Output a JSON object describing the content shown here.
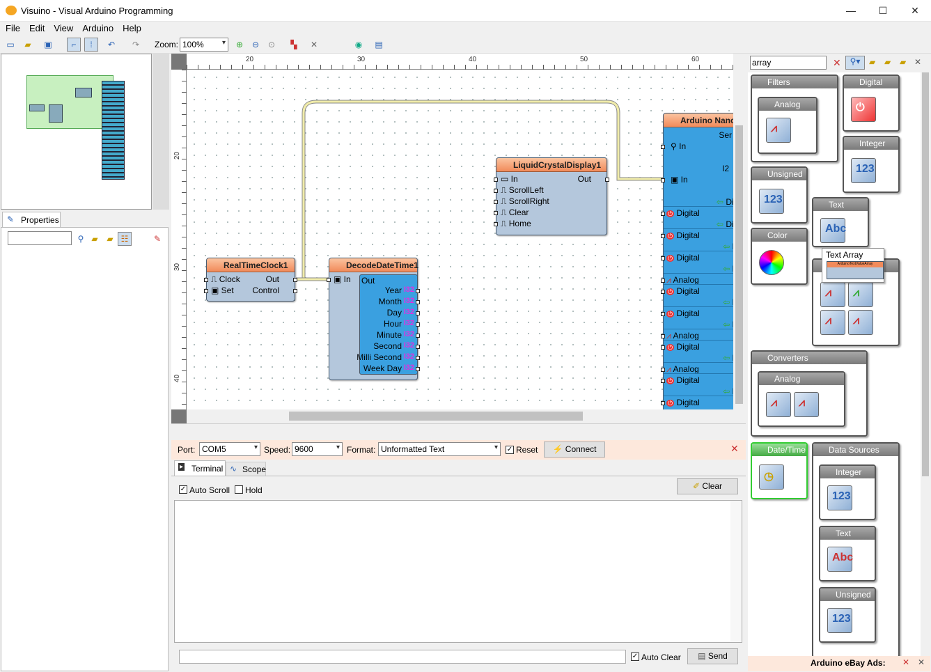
{
  "window": {
    "title": "Visuino - Visual Arduino Programming",
    "min": "—",
    "max": "☐",
    "close": "✕"
  },
  "menu": [
    "File",
    "Edit",
    "View",
    "Arduino",
    "Help"
  ],
  "toolbar": {
    "zoom_label": "Zoom:",
    "zoom_value": "100%"
  },
  "properties": {
    "tab": "Properties"
  },
  "ruler": {
    "top": [
      "20",
      "30",
      "40",
      "50",
      "60"
    ],
    "left": [
      "20",
      "30",
      "40"
    ]
  },
  "components": {
    "rtc": {
      "title": "RealTimeClock1",
      "pins": [
        "Clock",
        "Set"
      ],
      "outs": [
        "Out",
        "Control"
      ]
    },
    "decode": {
      "title": "DecodeDateTime1",
      "in": "In",
      "out": "Out",
      "outs": [
        "Year",
        "Month",
        "Day",
        "Hour",
        "Minute",
        "Second",
        "Milli Second",
        "Week Day"
      ],
      "type": "I32"
    },
    "lcd": {
      "title": "LiquidCrystalDisplay1",
      "ins": [
        "In",
        "ScrollLeft",
        "ScrollRight",
        "Clear",
        "Home"
      ],
      "out": "Out"
    },
    "nano": {
      "title": "Arduino Nano",
      "ser": "Ser",
      "in1": "In",
      "in2": "In",
      "i2": "I2",
      "rows": [
        "Digital",
        "Digital",
        "Digital",
        "Analog",
        "Digital",
        "Digital",
        "Analog",
        "Digital",
        "Analog",
        "Digital",
        "Digital"
      ],
      "right": [
        "Digi",
        "Digi",
        "Di",
        "Di",
        "Di",
        "Di",
        "Di",
        "Di"
      ]
    }
  },
  "serial": {
    "port_label": "Port:",
    "port": "COM5",
    "speed_label": "Speed:",
    "speed": "9600",
    "format_label": "Format:",
    "format": "Unformatted Text",
    "reset": "Reset",
    "connect": "Connect",
    "tabs": [
      "Terminal",
      "Scope"
    ],
    "auto_scroll": "Auto Scroll",
    "hold": "Hold",
    "clear": "Clear",
    "auto_clear": "Auto Clear",
    "send": "Send"
  },
  "palette": {
    "search": "array",
    "filters": "Filters",
    "analog": "Analog",
    "digital": "Digital",
    "integer": "Integer",
    "unsigned": "Unsigned",
    "text": "Text",
    "color": "Color",
    "tooltip": "Text Array",
    "tooltip_mini": "ArduinoTextValueArray",
    "converters": "Converters",
    "conv_analog": "Analog",
    "datetime": "Date/Time",
    "datasources": "Data Sources",
    "ds_integer": "Integer",
    "ds_text": "Text",
    "ds_unsigned": "Unsigned"
  },
  "ads": "Arduino eBay Ads:"
}
